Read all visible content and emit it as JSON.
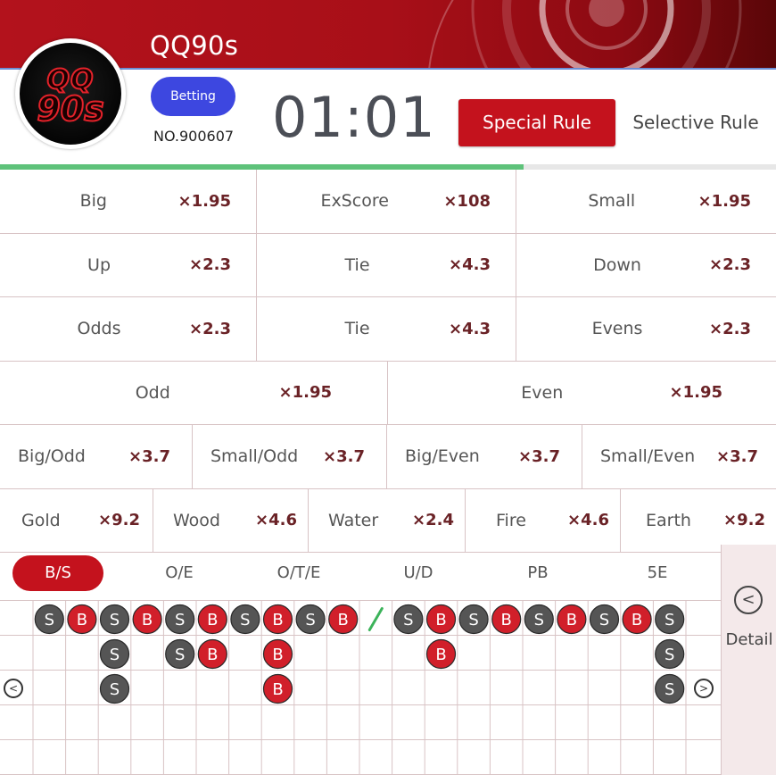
{
  "header": {
    "title": "QQ90s",
    "logo_line1": "QQ",
    "logo_line2": "90s",
    "status": "Betting",
    "round_no": "NO.900607",
    "timer": "01:01",
    "special_rule": "Special Rule",
    "selective_rule": "Selective Rule",
    "progress_fraction": 0.675,
    "brand_color": "#c4121d",
    "status_color": "#3d47e0"
  },
  "bets": [
    [
      {
        "name": "Big",
        "odds": "×1.95"
      },
      {
        "name": "ExScore",
        "odds": "×108"
      },
      {
        "name": "Small",
        "odds": "×1.95"
      }
    ],
    [
      {
        "name": "Up",
        "odds": "×2.3"
      },
      {
        "name": "Tie",
        "odds": "×4.3"
      },
      {
        "name": "Down",
        "odds": "×2.3"
      }
    ],
    [
      {
        "name": "Odds",
        "odds": "×2.3"
      },
      {
        "name": "Tie",
        "odds": "×4.3"
      },
      {
        "name": "Evens",
        "odds": "×2.3"
      }
    ],
    [
      {
        "name": "Odd",
        "odds": "×1.95"
      },
      {
        "name": "Even",
        "odds": "×1.95"
      }
    ],
    [
      {
        "name": "Big/Odd",
        "odds": "×3.7"
      },
      {
        "name": "Small/Odd",
        "odds": "×3.7"
      },
      {
        "name": "Big/Even",
        "odds": "×3.7"
      },
      {
        "name": "Small/Even",
        "odds": "×3.7"
      }
    ],
    [
      {
        "name": "Gold",
        "odds": "×9.2"
      },
      {
        "name": "Wood",
        "odds": "×4.6"
      },
      {
        "name": "Water",
        "odds": "×2.4"
      },
      {
        "name": "Fire",
        "odds": "×4.6"
      },
      {
        "name": "Earth",
        "odds": "×9.2"
      }
    ]
  ],
  "trend": {
    "tabs": [
      "B/S",
      "O/E",
      "O/T/E",
      "U/D",
      "PB",
      "5E"
    ],
    "active_tab": "B/S",
    "detail_label": "Detail",
    "columns": [
      [
        "S",
        "",
        ""
      ],
      [
        "B",
        "",
        ""
      ],
      [
        "S",
        "S",
        "S"
      ],
      [
        "B",
        "",
        ""
      ],
      [
        "S",
        "S",
        ""
      ],
      [
        "B",
        "B",
        ""
      ],
      [
        "S",
        "",
        ""
      ],
      [
        "B",
        "B",
        "B"
      ],
      [
        "S",
        "",
        ""
      ],
      [
        "B",
        "",
        ""
      ],
      [
        "/",
        "",
        ""
      ],
      [
        "S",
        "",
        ""
      ],
      [
        "B",
        "B",
        ""
      ],
      [
        "S",
        "",
        ""
      ],
      [
        "B",
        "",
        ""
      ],
      [
        "S",
        "",
        ""
      ],
      [
        "B",
        "",
        ""
      ],
      [
        "S",
        "",
        ""
      ],
      [
        "B",
        "",
        ""
      ],
      [
        "S",
        "S",
        "S"
      ]
    ],
    "colors": {
      "B": "#d11f2a",
      "S": "#555555",
      "divider": "#3cb35a"
    }
  }
}
